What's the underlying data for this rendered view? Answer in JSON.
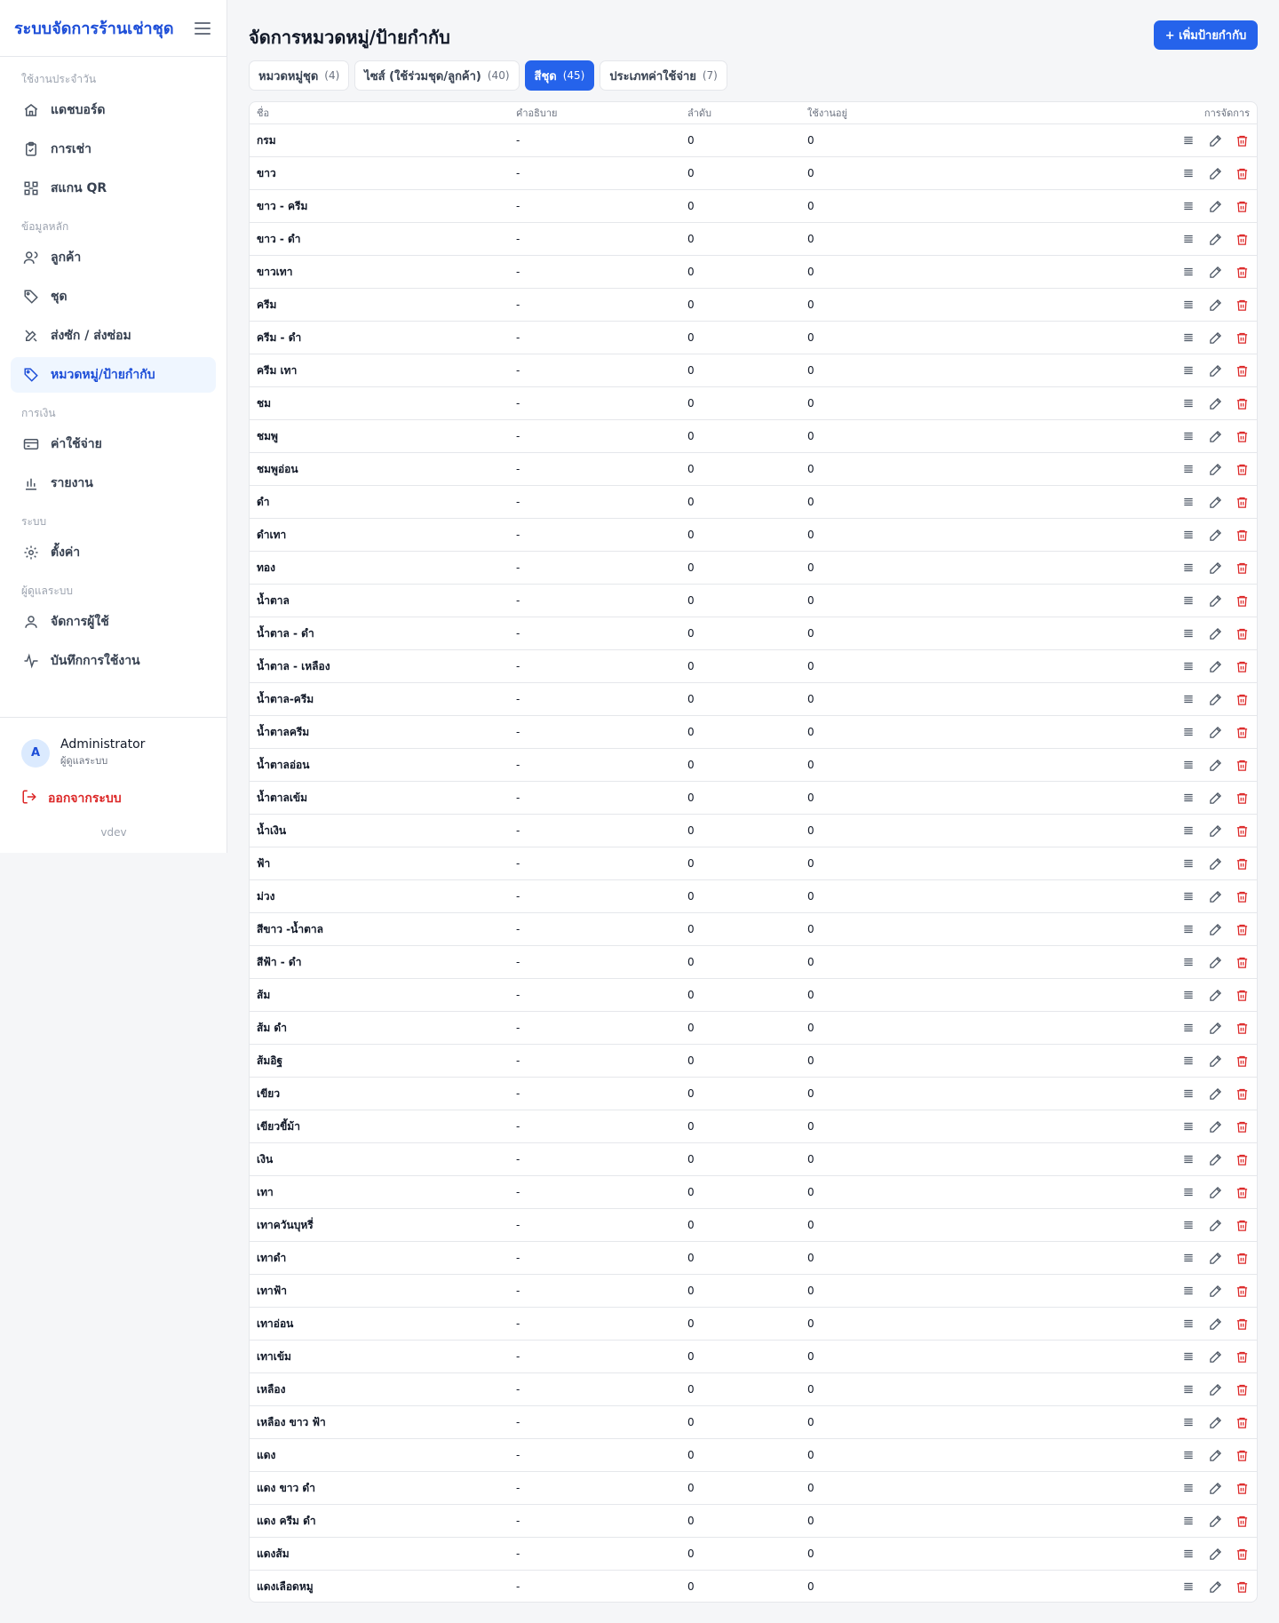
{
  "app": {
    "title": "ระบบจัดการร้านเช่าชุด"
  },
  "sidebar": {
    "sections": [
      {
        "label": "ใช้งานประจำวัน"
      },
      {
        "label": "ข้อมูลหลัก"
      },
      {
        "label": "การเงิน"
      },
      {
        "label": "ระบบ"
      },
      {
        "label": "ผู้ดูแลระบบ"
      }
    ],
    "items": [
      {
        "label": "แดชบอร์ด",
        "icon": "home-icon"
      },
      {
        "label": "การเช่า",
        "icon": "clipboard-icon"
      },
      {
        "label": "สแกน QR",
        "icon": "qr-scan-icon"
      },
      {
        "label": "ลูกค้า",
        "icon": "users-icon"
      },
      {
        "label": "ชุด",
        "icon": "tag-icon"
      },
      {
        "label": "ส่งซัก / ส่งซ่อม",
        "icon": "tools-icon"
      },
      {
        "label": "หมวดหมู่/ป้ายกำกับ",
        "icon": "tag-icon",
        "active": true
      },
      {
        "label": "ค่าใช้จ่าย",
        "icon": "credit-card-icon"
      },
      {
        "label": "รายงาน",
        "icon": "bar-chart-icon"
      },
      {
        "label": "ตั้งค่า",
        "icon": "gear-icon"
      },
      {
        "label": "จัดการผู้ใช้",
        "icon": "user-icon"
      },
      {
        "label": "บันทึกการใช้งาน",
        "icon": "activity-icon"
      }
    ],
    "user": {
      "initial": "A",
      "name": "Administrator",
      "role": "ผู้ดูแลระบบ"
    },
    "logout_label": "ออกจากระบบ",
    "version": "vdev"
  },
  "main": {
    "title": "จัดการหมวดหมู่/ป้ายกำกับ",
    "add_button": "+ เพิ่มป้ายกำกับ",
    "tabs": [
      {
        "label": "หมวดหมู่ชุด",
        "count": "(4)"
      },
      {
        "label": "ไซส์ (ใช้ร่วมชุด/ลูกค้า)",
        "count": "(40)"
      },
      {
        "label": "สีชุด",
        "count": "(45)",
        "active": true
      },
      {
        "label": "ประเภทค่าใช้จ่าย",
        "count": "(7)"
      }
    ],
    "table": {
      "headers": {
        "name": "ชื่อ",
        "description": "คำอธิบาย",
        "order": "ลำดับ",
        "usage": "ใช้งานอยู่",
        "actions": "การจัดการ"
      },
      "rows": [
        {
          "name": "กรม",
          "description": "-",
          "order": "0",
          "usage": "0"
        },
        {
          "name": "ขาว",
          "description": "-",
          "order": "0",
          "usage": "0"
        },
        {
          "name": "ขาว - ครีม",
          "description": "-",
          "order": "0",
          "usage": "0"
        },
        {
          "name": "ขาว - ดำ",
          "description": "-",
          "order": "0",
          "usage": "0"
        },
        {
          "name": "ขาวเทา",
          "description": "-",
          "order": "0",
          "usage": "0"
        },
        {
          "name": "ครีม",
          "description": "-",
          "order": "0",
          "usage": "0"
        },
        {
          "name": "ครีม - ดำ",
          "description": "-",
          "order": "0",
          "usage": "0"
        },
        {
          "name": "ครีม เทา",
          "description": "-",
          "order": "0",
          "usage": "0"
        },
        {
          "name": "ชม",
          "description": "-",
          "order": "0",
          "usage": "0"
        },
        {
          "name": "ชมพู",
          "description": "-",
          "order": "0",
          "usage": "0"
        },
        {
          "name": "ชมพูอ่อน",
          "description": "-",
          "order": "0",
          "usage": "0"
        },
        {
          "name": "ดำ",
          "description": "-",
          "order": "0",
          "usage": "0"
        },
        {
          "name": "ดำเทา",
          "description": "-",
          "order": "0",
          "usage": "0"
        },
        {
          "name": "ทอง",
          "description": "-",
          "order": "0",
          "usage": "0"
        },
        {
          "name": "น้ำตาล",
          "description": "-",
          "order": "0",
          "usage": "0"
        },
        {
          "name": "น้ำตาล - ดำ",
          "description": "-",
          "order": "0",
          "usage": "0"
        },
        {
          "name": "น้ำตาล - เหลือง",
          "description": "-",
          "order": "0",
          "usage": "0"
        },
        {
          "name": "น้ำตาล-ครีม",
          "description": "-",
          "order": "0",
          "usage": "0"
        },
        {
          "name": "น้ำตาลครีม",
          "description": "-",
          "order": "0",
          "usage": "0"
        },
        {
          "name": "น้ำตาลอ่อน",
          "description": "-",
          "order": "0",
          "usage": "0"
        },
        {
          "name": "น้ำตาลเข้ม",
          "description": "-",
          "order": "0",
          "usage": "0"
        },
        {
          "name": "น้ำเงิน",
          "description": "-",
          "order": "0",
          "usage": "0"
        },
        {
          "name": "ฟ้า",
          "description": "-",
          "order": "0",
          "usage": "0"
        },
        {
          "name": "ม่วง",
          "description": "-",
          "order": "0",
          "usage": "0"
        },
        {
          "name": "สีขาว -น้ำตาล",
          "description": "-",
          "order": "0",
          "usage": "0"
        },
        {
          "name": "สีฟ้า - ดำ",
          "description": "-",
          "order": "0",
          "usage": "0"
        },
        {
          "name": "ส้ม",
          "description": "-",
          "order": "0",
          "usage": "0"
        },
        {
          "name": "ส้ม ดำ",
          "description": "-",
          "order": "0",
          "usage": "0"
        },
        {
          "name": "ส้มอิฐ",
          "description": "-",
          "order": "0",
          "usage": "0"
        },
        {
          "name": "เขียว",
          "description": "-",
          "order": "0",
          "usage": "0"
        },
        {
          "name": "เขียวขี้ม้า",
          "description": "-",
          "order": "0",
          "usage": "0"
        },
        {
          "name": "เงิน",
          "description": "-",
          "order": "0",
          "usage": "0"
        },
        {
          "name": "เทา",
          "description": "-",
          "order": "0",
          "usage": "0"
        },
        {
          "name": "เทาควันบุหรี่",
          "description": "-",
          "order": "0",
          "usage": "0"
        },
        {
          "name": "เทาดำ",
          "description": "-",
          "order": "0",
          "usage": "0"
        },
        {
          "name": "เทาฟ้า",
          "description": "-",
          "order": "0",
          "usage": "0"
        },
        {
          "name": "เทาอ่อน",
          "description": "-",
          "order": "0",
          "usage": "0"
        },
        {
          "name": "เทาเข้ม",
          "description": "-",
          "order": "0",
          "usage": "0"
        },
        {
          "name": "เหลือง",
          "description": "-",
          "order": "0",
          "usage": "0"
        },
        {
          "name": "เหลือง ขาว ฟ้า",
          "description": "-",
          "order": "0",
          "usage": "0"
        },
        {
          "name": "แดง",
          "description": "-",
          "order": "0",
          "usage": "0"
        },
        {
          "name": "แดง ขาว ดำ",
          "description": "-",
          "order": "0",
          "usage": "0"
        },
        {
          "name": "แดง ครีม ดำ",
          "description": "-",
          "order": "0",
          "usage": "0"
        },
        {
          "name": "แดงส้ม",
          "description": "-",
          "order": "0",
          "usage": "0"
        },
        {
          "name": "แดงเลือดหมู",
          "description": "-",
          "order": "0",
          "usage": "0"
        }
      ]
    }
  },
  "colors": {
    "accent": "#2563eb",
    "brand": "#1d4ed8",
    "danger": "#dc2626"
  }
}
